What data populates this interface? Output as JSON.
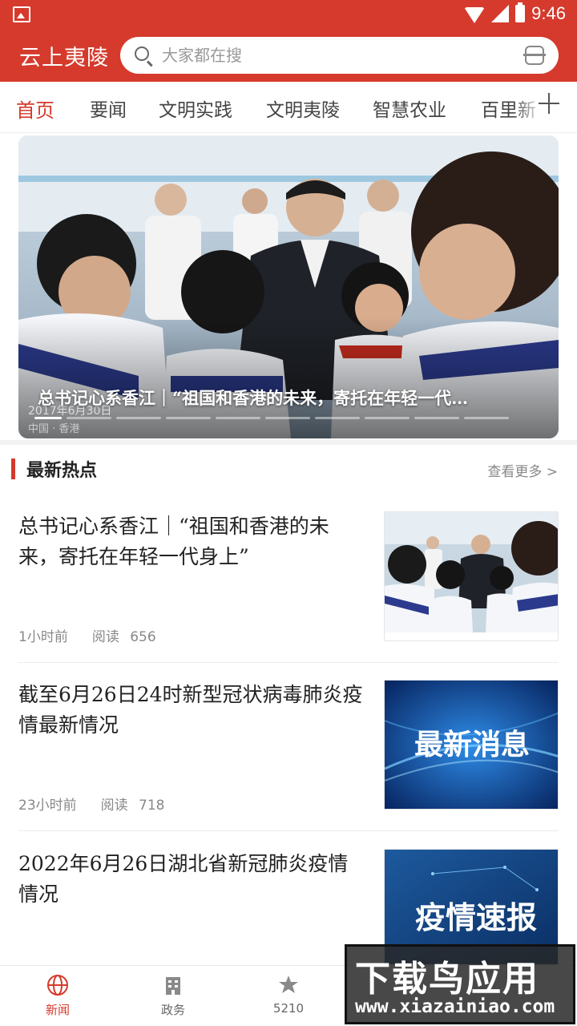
{
  "status_bar": {
    "time": "9:46"
  },
  "header": {
    "title": "云上夷陵",
    "search_placeholder": "大家都在搜"
  },
  "tabs": [
    {
      "label": "首页",
      "active": true
    },
    {
      "label": "要闻",
      "active": false
    },
    {
      "label": "文明实践",
      "active": false
    },
    {
      "label": "文明夷陵",
      "active": false
    },
    {
      "label": "智慧农业",
      "active": false
    },
    {
      "label": "百里新",
      "active": false
    }
  ],
  "banner": {
    "caption": "总书记心系香江｜“祖国和香港的未来，寄托在年轻一代…",
    "photo_overlay_text": {
      "date": "2017年6月30日",
      "place": "中国 · 香港"
    },
    "slide_count": 10,
    "active_slide": 1
  },
  "section": {
    "title": "最新热点",
    "more_label": "查看更多 >"
  },
  "news": [
    {
      "title": "总书记心系香江｜“祖国和香港的未来，寄托在年轻一代身上”",
      "time": "1小时前",
      "read_label": "阅读",
      "reads": "656",
      "thumb_text": ""
    },
    {
      "title": "截至6月26日24时新型冠状病毒肺炎疫情最新情况",
      "time": "23小时前",
      "read_label": "阅读",
      "reads": "718",
      "thumb_text": "最新消息"
    },
    {
      "title": "2022年6月26日湖北省新冠肺炎疫情情况",
      "time": "",
      "read_label": "",
      "reads": "",
      "thumb_text": "疫情速报"
    }
  ],
  "bottom_nav": [
    {
      "label": "新闻",
      "icon": "globe-icon",
      "active": true
    },
    {
      "label": "政务",
      "icon": "building-icon",
      "active": false
    },
    {
      "label": "5210",
      "icon": "leaf-icon",
      "active": false
    }
  ],
  "watermark": {
    "text": "下载鸟应用",
    "url": "www.xiazainiao.com"
  },
  "colors": {
    "brand": "#d53a2c",
    "text": "#222222",
    "muted": "#888888"
  }
}
